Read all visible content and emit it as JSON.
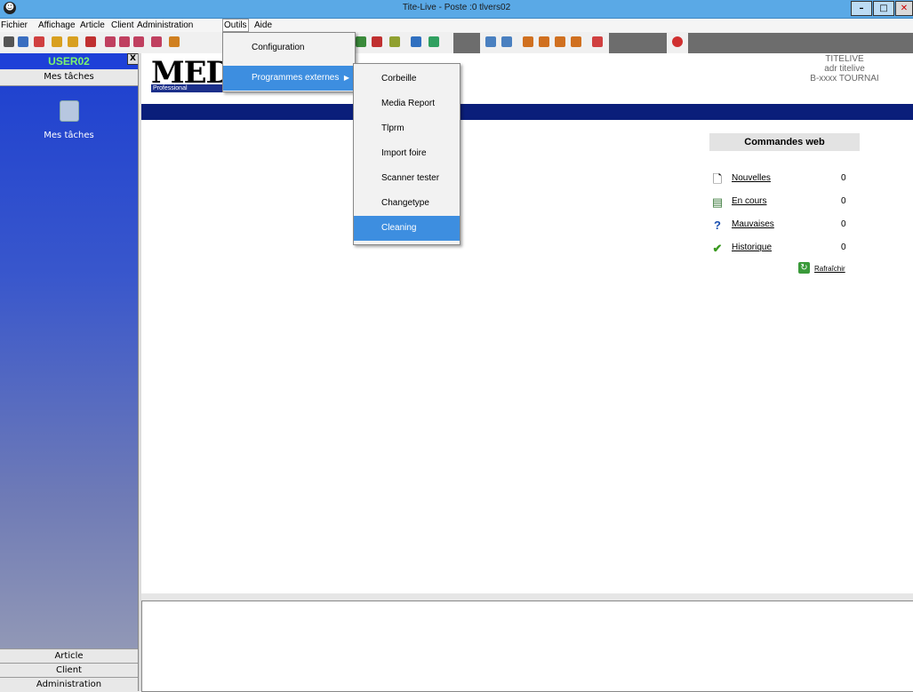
{
  "window": {
    "title": "Tite-Live - Poste :0 tlvers02"
  },
  "menu": [
    "Fichier",
    "Affichage",
    "Article",
    "Client",
    "Administration",
    "Outils",
    "Aide"
  ],
  "outils_menu": {
    "items": [
      "Configuration",
      "Programmes externes"
    ]
  },
  "external_programs": [
    "Corbeille",
    "Media Report",
    "Tlprm",
    "Import foire",
    "Scanner tester",
    "Changetype",
    "Cleaning"
  ],
  "left_panel": {
    "user": "USER02",
    "section": "Mes tâches",
    "task_label": "Mes tâches",
    "nav": [
      "Article",
      "Client",
      "Administration"
    ]
  },
  "logo": {
    "text": "MEDI",
    "subtitle": "Professional"
  },
  "company": {
    "line1": "TITELIVE",
    "line2": "adr titelive",
    "line3": "B-xxxx TOURNAI"
  },
  "web_orders": {
    "title": "Commandes web",
    "rows": [
      {
        "label": "Nouvelles",
        "count": "0",
        "icon": "new-document-icon"
      },
      {
        "label": "En cours",
        "count": "0",
        "icon": "in-progress-icon"
      },
      {
        "label": "Mauvaises",
        "count": "0",
        "icon": "question-icon"
      },
      {
        "label": "Historique",
        "count": "0",
        "icon": "checkmark-icon"
      }
    ],
    "refresh": "Rafraîchir"
  },
  "colors": {
    "titlebar": "#5aa9e6",
    "highlight": "#3d8ee0",
    "panel": "#1c3fd0",
    "band": "#0a1e7a",
    "user_text": "#7cf56e"
  }
}
